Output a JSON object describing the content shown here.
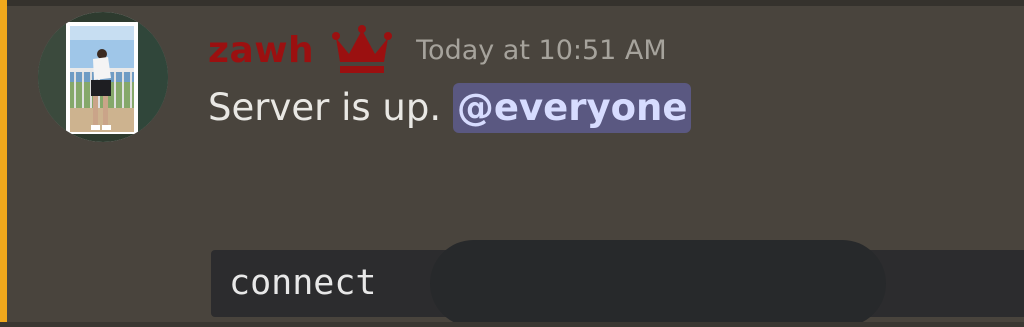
{
  "message": {
    "author": {
      "name": "zawh",
      "name_color": "#9b1010",
      "badge_icon": "crown-icon",
      "avatar_icon": "user-avatar-photo"
    },
    "timestamp": "Today at 10:51 AM",
    "text": "Server is up.",
    "mention": "@everyone",
    "code": "connect"
  },
  "colors": {
    "background": "#49443d",
    "mention_highlight": "#f0a81c",
    "mention_background": "#5a5881",
    "mention_text": "#d7dcff",
    "code_background": "#2c2c2e"
  }
}
